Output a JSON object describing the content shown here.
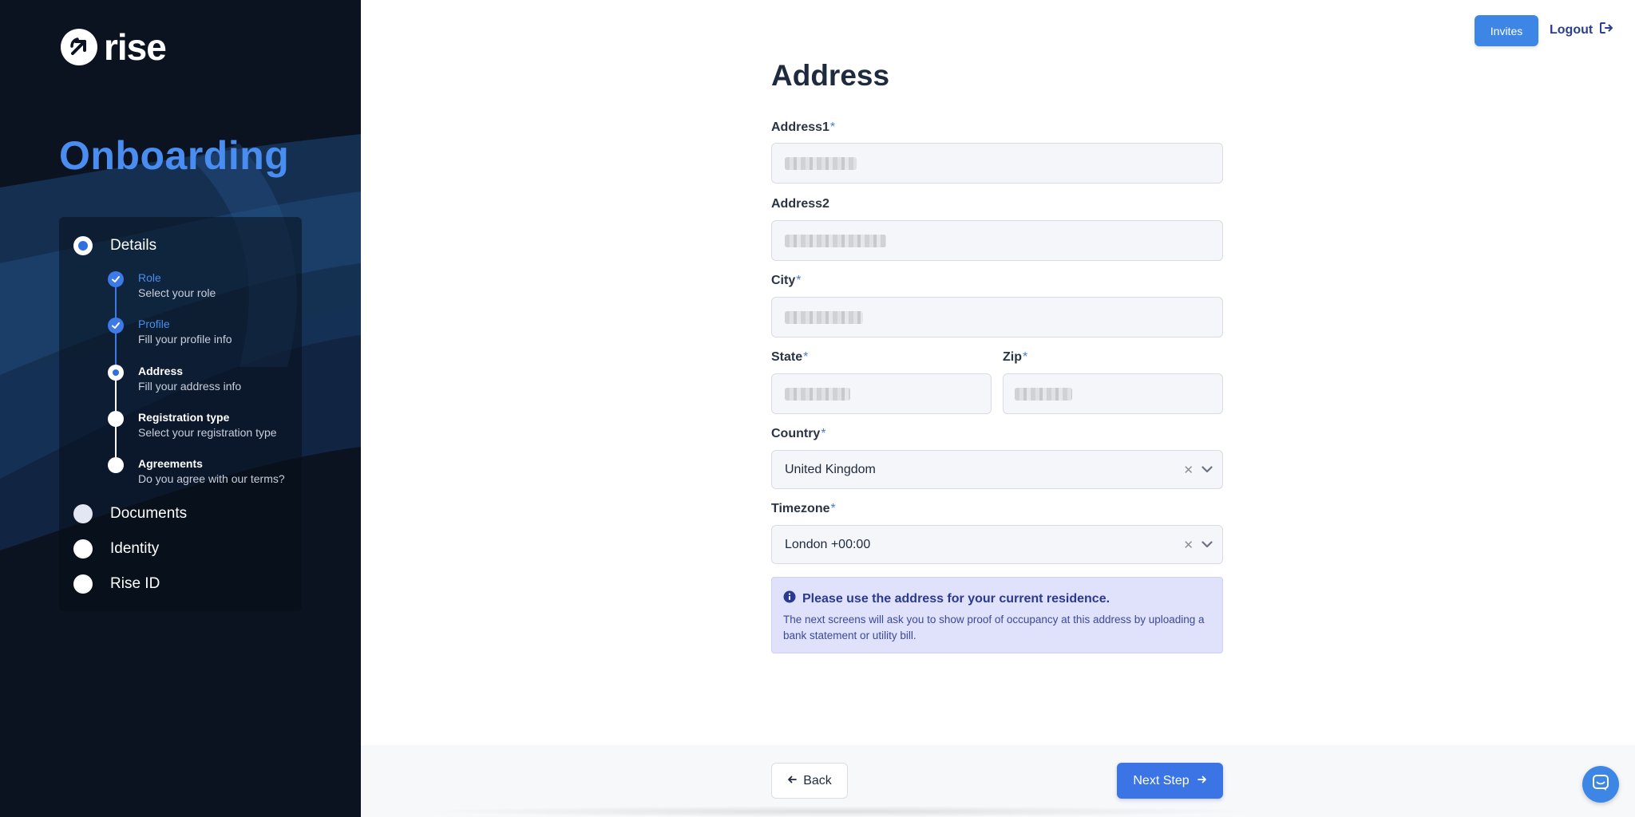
{
  "brand": {
    "name": "rise"
  },
  "sidebar": {
    "title": "Onboarding",
    "steps": [
      {
        "label": "Details",
        "state": "active"
      },
      {
        "label": "Documents",
        "state": "pending"
      },
      {
        "label": "Identity",
        "state": "pending"
      },
      {
        "label": "Rise ID",
        "state": "pending"
      }
    ],
    "substeps": [
      {
        "title": "Role",
        "subtitle": "Select your role",
        "state": "done"
      },
      {
        "title": "Profile",
        "subtitle": "Fill your profile info",
        "state": "done"
      },
      {
        "title": "Address",
        "subtitle": "Fill your address info",
        "state": "current"
      },
      {
        "title": "Registration type",
        "subtitle": "Select your registration type",
        "state": "todo"
      },
      {
        "title": "Agreements",
        "subtitle": "Do you agree with our terms?",
        "state": "todo"
      }
    ]
  },
  "header": {
    "invites": "Invites",
    "logout": "Logout"
  },
  "form": {
    "title": "Address",
    "required_mark": "*",
    "address1": {
      "label": "Address1"
    },
    "address2": {
      "label": "Address2"
    },
    "city": {
      "label": "City"
    },
    "state": {
      "label": "State"
    },
    "zip": {
      "label": "Zip"
    },
    "country": {
      "label": "Country",
      "value": "United Kingdom"
    },
    "timezone": {
      "label": "Timezone",
      "value": "London +00:00"
    },
    "clear_glyph": "✕"
  },
  "notice": {
    "title": "Please use the address for your current residence.",
    "body": "The next screens will ask you to show proof of occupancy at this address by uploading a bank statement or utility bill."
  },
  "footer": {
    "back": "Back",
    "next": "Next Step"
  },
  "colors": {
    "accent": "#3b74e4",
    "sidebar_bg": "#0b1220",
    "title_blue": "#4a8df0",
    "notice_bg": "#e0e1fb"
  },
  "icons": [
    "rise-logo-icon",
    "logout-icon",
    "info-icon",
    "clear-icon",
    "chevron-down-icon",
    "arrow-left-icon",
    "arrow-right-icon",
    "check-icon",
    "chat-icon"
  ]
}
